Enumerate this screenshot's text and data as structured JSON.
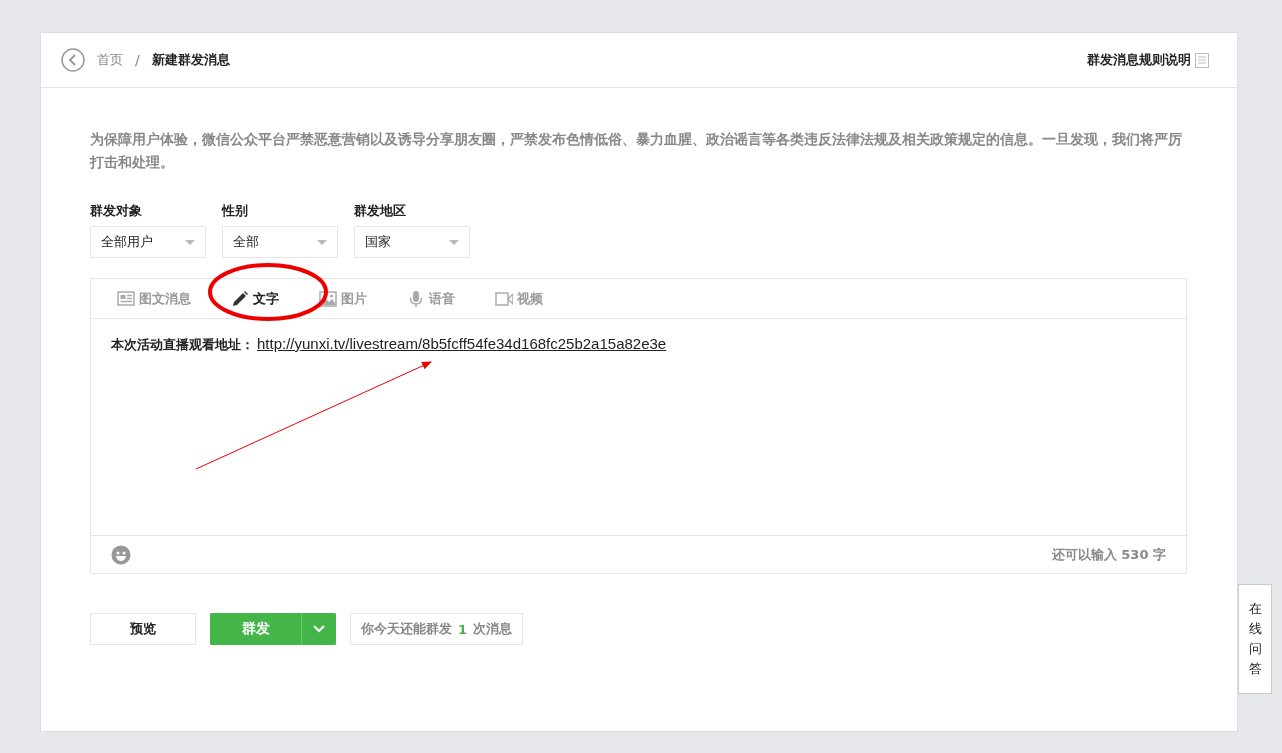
{
  "breadcrumb": {
    "home": "首页",
    "separator": "/",
    "current": "新建群发消息"
  },
  "rules_link": "群发消息规则说明",
  "notice": "为保障用户体验，微信公众平台严禁恶意营销以及诱导分享朋友圈，严禁发布色情低俗、暴力血腥、政治谣言等各类违反法律法规及相关政策规定的信息。一旦发现，我们将严厉打击和处理。",
  "filters": [
    {
      "label": "群发对象",
      "value": "全部用户"
    },
    {
      "label": "性别",
      "value": "全部"
    },
    {
      "label": "群发地区",
      "value": "国家"
    }
  ],
  "tabs": [
    {
      "label": "图文消息",
      "kind": "news",
      "selected": false
    },
    {
      "label": "文字",
      "kind": "text",
      "selected": true
    },
    {
      "label": "图片",
      "kind": "image",
      "selected": false
    },
    {
      "label": "语音",
      "kind": "voice",
      "selected": false
    },
    {
      "label": "视频",
      "kind": "video",
      "selected": false
    }
  ],
  "message": {
    "text": "本次活动直播观看地址：",
    "link": "http://yunxi.tv/livestream/8b5fcff54fe34d168fc25b2a15a82e3e"
  },
  "char_count": "还可以输入 530 字",
  "buttons": {
    "preview": "预览",
    "send": "群发"
  },
  "quota": {
    "prefix": "你今天还能群发",
    "count": "1",
    "suffix": "次消息"
  },
  "side_tab": "在线问答"
}
